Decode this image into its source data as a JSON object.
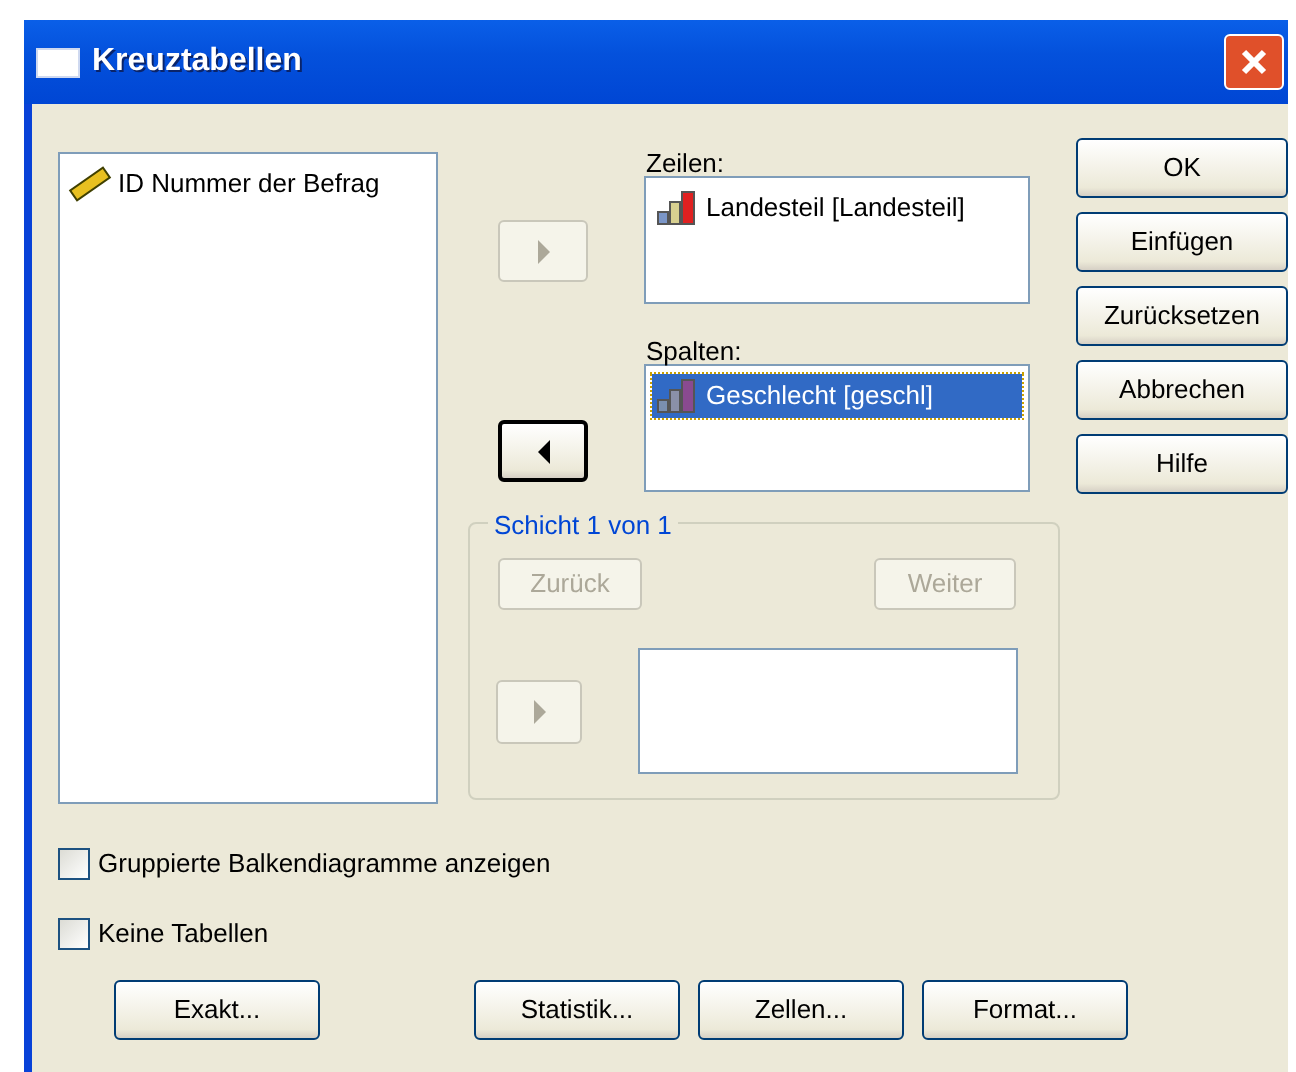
{
  "window": {
    "title": "Kreuztabellen"
  },
  "source_list": {
    "items": [
      {
        "label": "ID Nummer der Befrag",
        "kind": "scale",
        "selected": false
      }
    ]
  },
  "rows": {
    "label": "Zeilen:",
    "arrow": {
      "kind": "right",
      "disabled": true
    },
    "items": [
      {
        "label": "Landesteil [Landesteil]",
        "kind": "nominal",
        "selected": false
      }
    ]
  },
  "columns": {
    "label": "Spalten:",
    "arrow": {
      "kind": "left",
      "disabled": false
    },
    "items": [
      {
        "label": "Geschlecht [geschl]",
        "kind": "nominal",
        "selected": true
      }
    ]
  },
  "layer": {
    "title": "Schicht 1 von 1",
    "back": {
      "label": "Zurück",
      "disabled": true
    },
    "next": {
      "label": "Weiter",
      "disabled": true
    },
    "arrow": {
      "kind": "right",
      "disabled": true
    }
  },
  "actions": [
    {
      "label": "OK"
    },
    {
      "label": "Einfügen"
    },
    {
      "label": "Zurücksetzen"
    },
    {
      "label": "Abbrechen"
    },
    {
      "label": "Hilfe"
    }
  ],
  "checkboxes": [
    {
      "label": "Gruppierte Balkendiagramme anzeigen",
      "checked": false
    },
    {
      "label": "Keine Tabellen",
      "checked": false
    }
  ],
  "bottom_buttons": [
    {
      "label": "Exakt..."
    },
    {
      "label": "Statistik..."
    },
    {
      "label": "Zellen..."
    },
    {
      "label": "Format..."
    }
  ]
}
